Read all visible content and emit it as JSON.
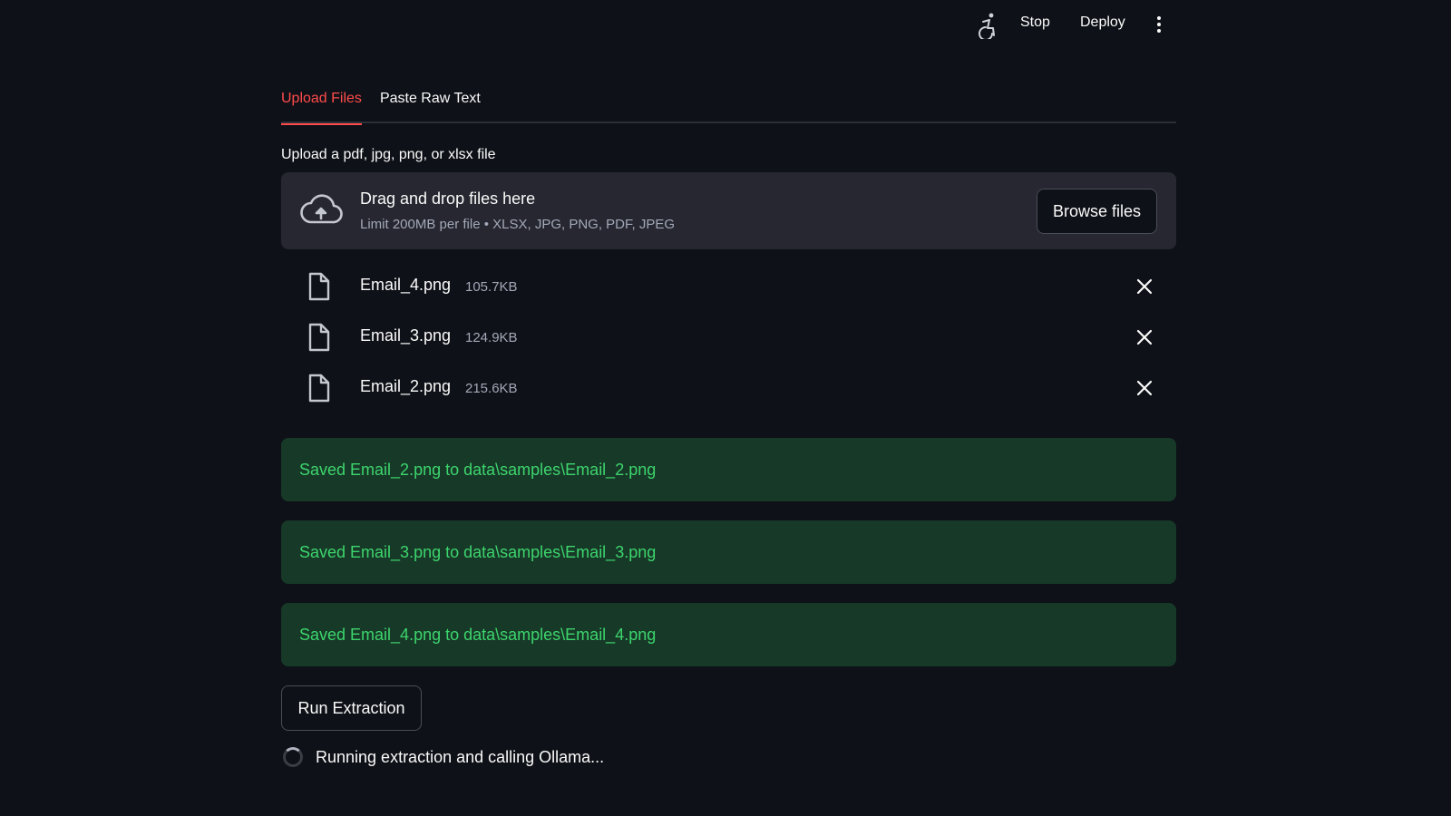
{
  "header": {
    "running_icon": "accessibility-running-icon",
    "stop_label": "Stop",
    "deploy_label": "Deploy",
    "menu_icon": "kebab-menu-icon"
  },
  "tabs": [
    {
      "label": "Upload Files",
      "active": true
    },
    {
      "label": "Paste Raw Text",
      "active": false
    }
  ],
  "uploader": {
    "label": "Upload a pdf, jpg, png, or xlsx file",
    "title": "Drag and drop files here",
    "limit": "Limit 200MB per file • XLSX, JPG, PNG, PDF, JPEG",
    "browse_label": "Browse files",
    "icon": "cloud-upload-icon"
  },
  "files": [
    {
      "name": "Email_4.png",
      "size": "105.7KB"
    },
    {
      "name": "Email_3.png",
      "size": "124.9KB"
    },
    {
      "name": "Email_2.png",
      "size": "215.6KB"
    }
  ],
  "alerts": [
    "Saved Email_2.png to data\\samples\\Email_2.png",
    "Saved Email_3.png to data\\samples\\Email_3.png",
    "Saved Email_4.png to data\\samples\\Email_4.png"
  ],
  "run_button": "Run Extraction",
  "status_text": "Running extraction and calling Ollama...",
  "colors": {
    "background": "#0e1117",
    "accent": "#ff4b4b",
    "success_bg": "#173928",
    "success_text": "#3dd56d",
    "panel": "#262730"
  }
}
